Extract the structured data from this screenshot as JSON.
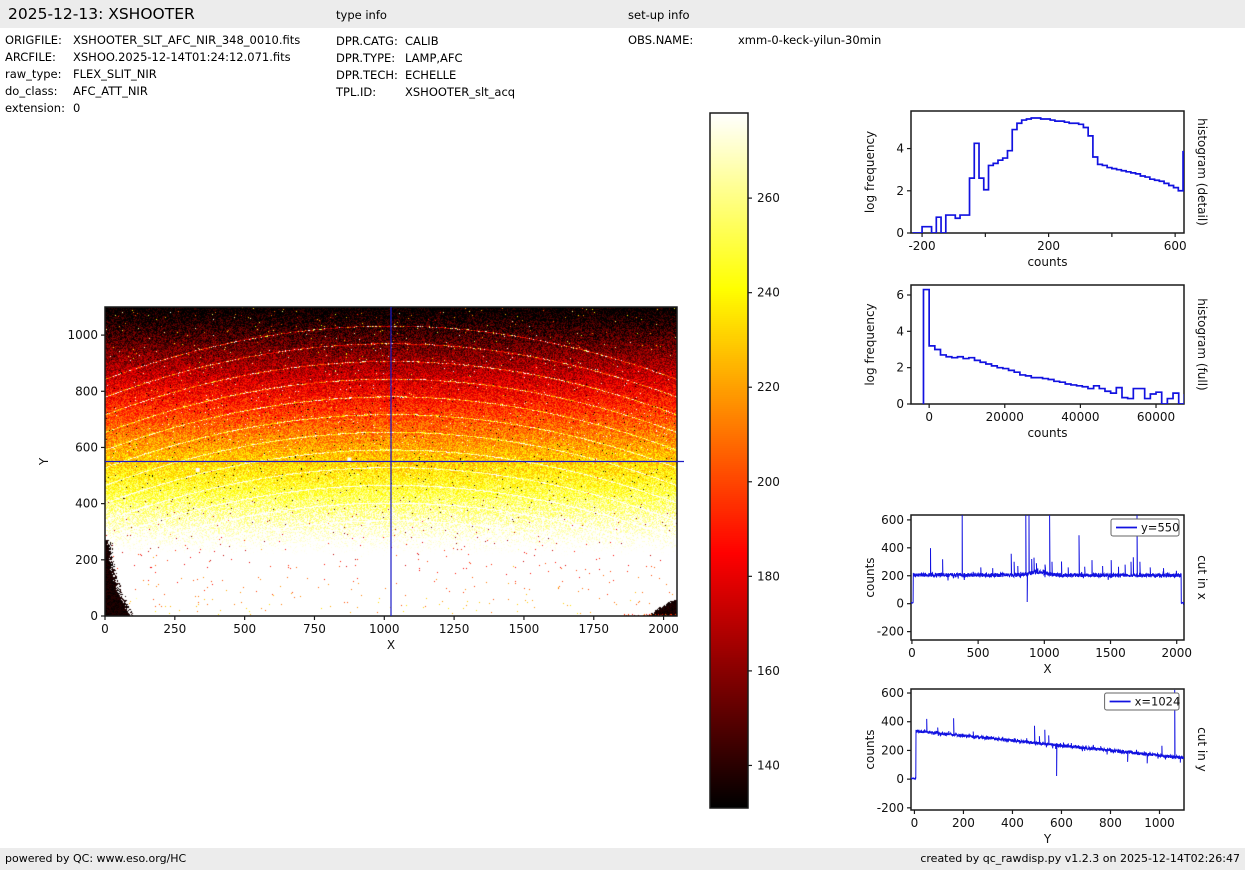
{
  "header": {
    "title": "2025-12-13: XSHOOTER"
  },
  "file_info": {
    "rows": [
      {
        "label": "ORIGFILE:",
        "value": "XSHOOTER_SLT_AFC_NIR_348_0010.fits"
      },
      {
        "label": "ARCFILE:",
        "value": "XSHOO.2025-12-14T01:24:12.071.fits"
      },
      {
        "label": "raw_type:",
        "value": "FLEX_SLIT_NIR"
      },
      {
        "label": "do_class:",
        "value": "AFC_ATT_NIR"
      },
      {
        "label": "extension:",
        "value": "0"
      }
    ]
  },
  "type_info": {
    "title": "type info",
    "rows": [
      {
        "label": "DPR.CATG:",
        "value": "CALIB"
      },
      {
        "label": "DPR.TYPE:",
        "value": "LAMP,AFC"
      },
      {
        "label": "DPR.TECH:",
        "value": "ECHELLE"
      },
      {
        "label": "TPL.ID:",
        "value": "XSHOOTER_slt_acq"
      }
    ]
  },
  "setup_info": {
    "title": "set-up info",
    "rows": [
      {
        "label": "OBS.NAME:",
        "value": "xmm-0-keck-yilun-30min"
      }
    ]
  },
  "footer": {
    "left": "powered by QC: www.eso.org/HC",
    "right": "created by qc_rawdisp.py v1.2.3 on 2025-12-14T02:26:47"
  },
  "colors": {
    "plot_line": "#1212e0",
    "crosshair": "#1b1bc8",
    "axis": "#1a1a1a",
    "bar_bg": "#ececec"
  },
  "chart_data": [
    {
      "id": "main-image",
      "type": "heatmap",
      "xlabel": "X",
      "ylabel": "Y",
      "xlim": [
        0,
        2048
      ],
      "ylim": [
        0,
        1100
      ],
      "xticks": [
        0,
        250,
        500,
        750,
        1000,
        1250,
        1500,
        1750,
        2000
      ],
      "yticks": [
        0,
        200,
        400,
        600,
        800,
        1000
      ],
      "colormap": "hot",
      "clim": [
        131,
        278
      ],
      "crosshair": {
        "x": 1024,
        "y": 550
      },
      "trend": {
        "counts_at_y0": 335,
        "slope_per_y": -0.19
      },
      "noise": 17,
      "arcs": {
        "count": 14,
        "first_center_y": 1032,
        "spacing": 63,
        "sag": 190
      },
      "bright_spots": [
        {
          "x": 875,
          "y": 557
        },
        {
          "x": 332,
          "y": 520
        }
      ],
      "dark_corners": [
        "bottom-left",
        "bottom-right"
      ]
    },
    {
      "id": "colorbar",
      "type": "colorbar",
      "colormap": "hot",
      "range": [
        131,
        278
      ],
      "ticks": [
        140,
        160,
        180,
        200,
        220,
        240,
        260
      ]
    },
    {
      "id": "histogram-detail",
      "type": "step-histogram",
      "xlabel": "counts",
      "ylabel": "log frequency",
      "right_label": "histogram (detail)",
      "xlim": [
        -235,
        628
      ],
      "ylim": [
        0,
        5.78
      ],
      "xticks": [
        {
          "v": -200,
          "l": "-200"
        },
        {
          "v": 0,
          "l": ""
        },
        {
          "v": 200,
          "l": "200"
        },
        {
          "v": 400,
          "l": ""
        },
        {
          "v": 600,
          "l": "600"
        }
      ],
      "yticks": [
        0,
        2,
        4
      ],
      "bin_start": -230,
      "bin_width": 15,
      "values": [
        0,
        0,
        0.3,
        0.3,
        0,
        0.75,
        0,
        0.85,
        0.85,
        0.7,
        0.85,
        0.85,
        2.6,
        4.25,
        2.6,
        2.05,
        3.2,
        3.3,
        3.45,
        3.55,
        3.9,
        4.9,
        5.2,
        5.35,
        5.4,
        5.45,
        5.45,
        5.4,
        5.4,
        5.35,
        5.3,
        5.3,
        5.25,
        5.2,
        5.2,
        5.15,
        5.0,
        4.6,
        3.6,
        3.25,
        3.2,
        3.1,
        3.05,
        3.0,
        2.95,
        2.9,
        2.85,
        2.8,
        2.7,
        2.65,
        2.55,
        2.5,
        2.45,
        2.35,
        2.25,
        2.15,
        2.0,
        3.85
      ]
    },
    {
      "id": "histogram-full",
      "type": "step-histogram",
      "xlabel": "counts",
      "ylabel": "log frequency",
      "right_label": "histogram (full)",
      "xlim": [
        -4800,
        67400
      ],
      "ylim": [
        0,
        6.55
      ],
      "xticks": [
        {
          "v": 0,
          "l": "0"
        },
        {
          "v": 20000,
          "l": "20000"
        },
        {
          "v": 40000,
          "l": "40000"
        },
        {
          "v": 60000,
          "l": "60000"
        }
      ],
      "yticks": [
        0,
        2,
        4,
        6
      ],
      "bin_start": -1500,
      "bin_width": 1500,
      "values": [
        6.3,
        3.2,
        3.0,
        2.7,
        2.6,
        2.55,
        2.6,
        2.5,
        2.55,
        2.4,
        2.3,
        2.2,
        2.1,
        2.0,
        1.95,
        1.85,
        1.75,
        1.6,
        1.55,
        1.45,
        1.45,
        1.4,
        1.35,
        1.25,
        1.2,
        1.1,
        1.05,
        1.0,
        0.95,
        0.85,
        1.0,
        0.85,
        0.7,
        0.6,
        0.9,
        0.35,
        0.3,
        0.85,
        0.85,
        0.3,
        0.55,
        0.65,
        0,
        0.3,
        0.6,
        0,
        0.5
      ]
    },
    {
      "id": "cut-in-x",
      "type": "noisy-line",
      "xlabel": "X",
      "ylabel": "counts",
      "right_label": "cut in x",
      "legend": "y=550",
      "xlim": [
        -7,
        2055
      ],
      "ylim": [
        -260,
        635
      ],
      "xticks": [
        {
          "v": 0,
          "l": "0"
        },
        {
          "v": 500,
          "l": "500"
        },
        {
          "v": 1000,
          "l": "1000"
        },
        {
          "v": 1500,
          "l": "1500"
        },
        {
          "v": 2000,
          "l": "2000"
        }
      ],
      "yticks": [
        -200,
        0,
        200,
        400,
        600
      ],
      "baseline": {
        "x0": 0,
        "v0": 207,
        "x1": 2055,
        "v1": 202
      },
      "noise": 14,
      "zero_below": 9,
      "zero_above": 2034,
      "seed": 11,
      "bumps": [
        {
          "x": 950,
          "w": 90,
          "h": 22
        }
      ],
      "spikes": [
        {
          "x": 140,
          "v": 398
        },
        {
          "x": 232,
          "v": 318
        },
        {
          "x": 380,
          "v": 634
        },
        {
          "x": 520,
          "v": 260
        },
        {
          "x": 610,
          "v": 255
        },
        {
          "x": 750,
          "v": 358
        },
        {
          "x": 772,
          "v": 300
        },
        {
          "x": 800,
          "v": 270
        },
        {
          "x": 860,
          "v": 634
        },
        {
          "x": 871,
          "v": 12
        },
        {
          "x": 884,
          "v": 634
        },
        {
          "x": 905,
          "v": 320
        },
        {
          "x": 922,
          "v": 330
        },
        {
          "x": 940,
          "v": 290
        },
        {
          "x": 1005,
          "v": 280
        },
        {
          "x": 1040,
          "v": 634
        },
        {
          "x": 1058,
          "v": 300
        },
        {
          "x": 1130,
          "v": 302
        },
        {
          "x": 1180,
          "v": 260
        },
        {
          "x": 1262,
          "v": 490
        },
        {
          "x": 1305,
          "v": 265
        },
        {
          "x": 1360,
          "v": 312
        },
        {
          "x": 1440,
          "v": 270
        },
        {
          "x": 1505,
          "v": 312
        },
        {
          "x": 1560,
          "v": 265
        },
        {
          "x": 1610,
          "v": 280
        },
        {
          "x": 1655,
          "v": 300
        },
        {
          "x": 1672,
          "v": 332
        },
        {
          "x": 1700,
          "v": 634
        },
        {
          "x": 1722,
          "v": 300
        },
        {
          "x": 1800,
          "v": 260
        },
        {
          "x": 1900,
          "v": 255
        }
      ]
    },
    {
      "id": "cut-in-y",
      "type": "noisy-line",
      "xlabel": "Y",
      "ylabel": "counts",
      "right_label": "cut in y",
      "legend": "x=1024",
      "xlim": [
        -14,
        1100
      ],
      "ylim": [
        -215,
        628
      ],
      "xticks": [
        {
          "v": 0,
          "l": "0"
        },
        {
          "v": 200,
          "l": "200"
        },
        {
          "v": 400,
          "l": "400"
        },
        {
          "v": 600,
          "l": "600"
        },
        {
          "v": 800,
          "l": "800"
        },
        {
          "v": 1000,
          "l": "1000"
        }
      ],
      "yticks": [
        -200,
        0,
        200,
        400,
        600
      ],
      "baseline": {
        "x0": 0,
        "v0": 337,
        "x1": 1100,
        "v1": 148
      },
      "noise": 11,
      "zero_below": 6,
      "zero_above": 99999,
      "seed": 21,
      "bumps": [],
      "spikes": [
        {
          "x": 50,
          "v": 420
        },
        {
          "x": 95,
          "v": 360
        },
        {
          "x": 160,
          "v": 424
        },
        {
          "x": 240,
          "v": 332
        },
        {
          "x": 300,
          "v": 300
        },
        {
          "x": 360,
          "v": 295
        },
        {
          "x": 420,
          "v": 280
        },
        {
          "x": 458,
          "v": 285
        },
        {
          "x": 490,
          "v": 372
        },
        {
          "x": 510,
          "v": 300
        },
        {
          "x": 532,
          "v": 344
        },
        {
          "x": 548,
          "v": 305
        },
        {
          "x": 580,
          "v": 22
        },
        {
          "x": 608,
          "v": 255
        },
        {
          "x": 640,
          "v": 252
        },
        {
          "x": 700,
          "v": 235
        },
        {
          "x": 760,
          "v": 230
        },
        {
          "x": 800,
          "v": 215
        },
        {
          "x": 870,
          "v": 120
        },
        {
          "x": 950,
          "v": 110
        },
        {
          "x": 1010,
          "v": 232
        },
        {
          "x": 1062,
          "v": 622
        },
        {
          "x": 1085,
          "v": 115
        }
      ]
    }
  ]
}
